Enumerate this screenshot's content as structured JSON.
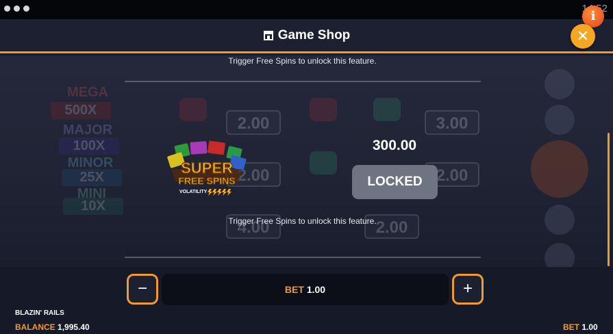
{
  "status_bar": {
    "clock": "14:52"
  },
  "header": {
    "title": "Game Shop"
  },
  "background": {
    "jackpots": [
      {
        "name": "MEGA",
        "value": "500X"
      },
      {
        "name": "MAJOR",
        "value": "100X"
      },
      {
        "name": "MINOR",
        "value": "25X"
      },
      {
        "name": "MINI",
        "value": "10X"
      }
    ],
    "reel_values": [
      "2.00",
      "3.00",
      "2.00",
      "2.00",
      "4.00",
      "2.00"
    ]
  },
  "shop_item": {
    "top_message": "Trigger Free Spins to unlock this feature.",
    "logo_title_1": "SUPER",
    "logo_title_2": "FREE SPINS",
    "logo_volatility": "VOLATILITY",
    "price": "300.00",
    "button_label": "LOCKED",
    "message": "Trigger Free Spins to unlock this feature."
  },
  "bet_controls": {
    "minus": "−",
    "plus": "+",
    "bet_label": "BET",
    "bet_value": "1.00"
  },
  "footer": {
    "game_name": "BLAZIN' RAILS",
    "balance_label": "BALANCE",
    "balance_value": "1,995.40",
    "bet_label": "BET",
    "bet_value": "1.00"
  },
  "colors": {
    "accent": "#f19a2f",
    "close": "#f5a623",
    "info": "#e4451a",
    "locked": "#6f7482"
  },
  "icons": [
    "shop-icon",
    "info-icon",
    "close-icon",
    "minus-icon",
    "plus-icon"
  ]
}
